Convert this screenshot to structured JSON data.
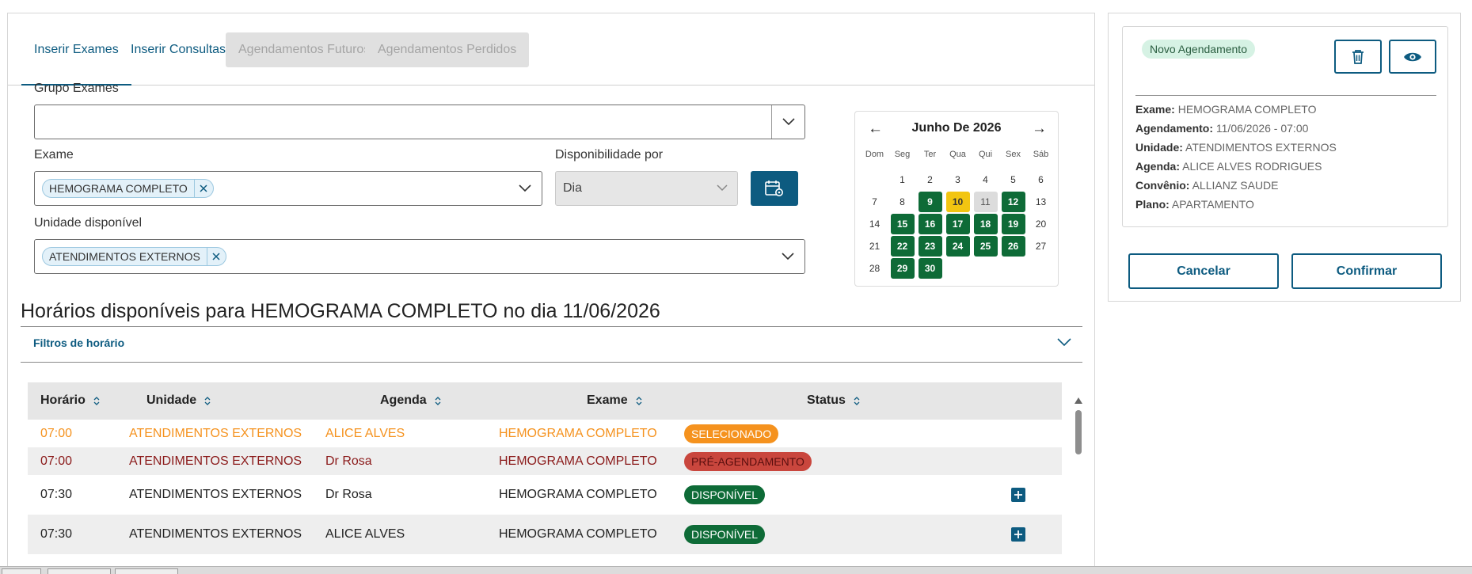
{
  "tabs": [
    {
      "label": "Inserir Exames",
      "state": "active"
    },
    {
      "label": "Inserir Consultas",
      "state": "normal"
    },
    {
      "label": "Agendamentos Futuros",
      "state": "disabled"
    },
    {
      "label": "Agendamentos Perdidos",
      "state": "disabled"
    }
  ],
  "form": {
    "grupo_label": "Grupo Exames",
    "grupo_value": "",
    "exame_label": "Exame",
    "exame_chip": "HEMOGRAMA COMPLETO",
    "disponibilidade_label": "Disponibilidade por",
    "disponibilidade_value": "Dia",
    "unidade_label": "Unidade disponível",
    "unidade_chip": "ATENDIMENTOS EXTERNOS"
  },
  "calendar": {
    "title": "Junho De 2026",
    "prev": "←",
    "next": "→",
    "weekdays": [
      "Dom",
      "Seg",
      "Ter",
      "Qua",
      "Qui",
      "Sex",
      "Sáb"
    ],
    "days": [
      {
        "d": "",
        "s": "empty"
      },
      {
        "d": "1",
        "s": "normal"
      },
      {
        "d": "2",
        "s": "normal"
      },
      {
        "d": "3",
        "s": "normal"
      },
      {
        "d": "4",
        "s": "normal"
      },
      {
        "d": "5",
        "s": "normal"
      },
      {
        "d": "6",
        "s": "normal"
      },
      {
        "d": "7",
        "s": "normal"
      },
      {
        "d": "8",
        "s": "normal"
      },
      {
        "d": "9",
        "s": "avail"
      },
      {
        "d": "10",
        "s": "selected"
      },
      {
        "d": "11",
        "s": "today"
      },
      {
        "d": "12",
        "s": "avail"
      },
      {
        "d": "13",
        "s": "normal"
      },
      {
        "d": "14",
        "s": "normal"
      },
      {
        "d": "15",
        "s": "avail"
      },
      {
        "d": "16",
        "s": "avail"
      },
      {
        "d": "17",
        "s": "avail"
      },
      {
        "d": "18",
        "s": "avail"
      },
      {
        "d": "19",
        "s": "avail"
      },
      {
        "d": "20",
        "s": "normal"
      },
      {
        "d": "21",
        "s": "normal"
      },
      {
        "d": "22",
        "s": "avail"
      },
      {
        "d": "23",
        "s": "avail"
      },
      {
        "d": "24",
        "s": "avail"
      },
      {
        "d": "25",
        "s": "avail"
      },
      {
        "d": "26",
        "s": "avail"
      },
      {
        "d": "27",
        "s": "normal"
      },
      {
        "d": "28",
        "s": "normal"
      },
      {
        "d": "29",
        "s": "avail"
      },
      {
        "d": "30",
        "s": "avail"
      }
    ]
  },
  "section_title": "Horários disponíveis para HEMOGRAMA COMPLETO no dia 11/06/2026",
  "filters_label": "Filtros de horário",
  "table": {
    "headers": [
      "Horário",
      "Unidade",
      "Agenda",
      "Exame",
      "Status"
    ],
    "rows": [
      {
        "time": "07:00",
        "unit": "ATENDIMENTOS EXTERNOS",
        "agenda": "ALICE ALVES",
        "exam": "HEMOGRAMA COMPLETO",
        "status": "SELECIONADO",
        "kind": "selected",
        "add": false
      },
      {
        "time": "07:00",
        "unit": "ATENDIMENTOS EXTERNOS",
        "agenda": "Dr Rosa",
        "exam": "HEMOGRAMA COMPLETO",
        "status": "PRÉ-AGENDAMENTO",
        "kind": "pre",
        "add": false
      },
      {
        "time": "07:30",
        "unit": "ATENDIMENTOS EXTERNOS",
        "agenda": "Dr Rosa",
        "exam": "HEMOGRAMA COMPLETO",
        "status": "DISPONÍVEL",
        "kind": "available",
        "add": true
      },
      {
        "time": "07:30",
        "unit": "ATENDIMENTOS EXTERNOS",
        "agenda": "ALICE ALVES",
        "exam": "HEMOGRAMA COMPLETO",
        "status": "DISPONÍVEL",
        "kind": "available",
        "add": true
      }
    ]
  },
  "summary": {
    "badge": "Novo Agendamento",
    "fields": [
      {
        "label": "Exame:",
        "value": "HEMOGRAMA COMPLETO"
      },
      {
        "label": "Agendamento:",
        "value": "11/06/2026 - 07:00"
      },
      {
        "label": "Unidade:",
        "value": "ATENDIMENTOS EXTERNOS"
      },
      {
        "label": "Agenda:",
        "value": "ALICE ALVES RODRIGUES"
      },
      {
        "label": "Convênio:",
        "value": "ALLIANZ SAUDE"
      },
      {
        "label": "Plano:",
        "value": "APARTAMENTO"
      }
    ],
    "cancel_label": "Cancelar",
    "confirm_label": "Confirmar"
  },
  "colors": {
    "primary": "#0d5b80",
    "available_green": "#0e6b37",
    "selected_yellow": "#f2c511",
    "selected_orange": "#f5921e",
    "pre_red": "#c9463d",
    "pre_text": "#8b1a1a"
  }
}
